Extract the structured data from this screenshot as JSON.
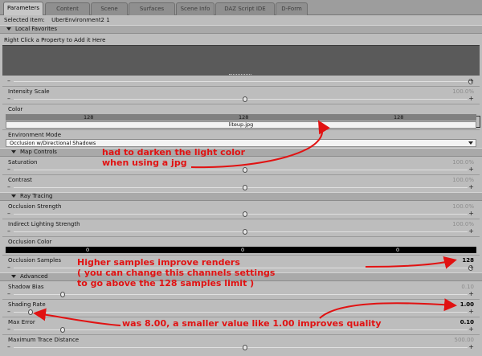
{
  "tabs": [
    "Parameters",
    "Content",
    "Scene",
    "Surfaces",
    "Scene Info",
    "DAZ Script IDE",
    "D-Form"
  ],
  "selected_item_label": "Selected Item:",
  "selected_item_value": "UberEnvironment2 1",
  "local_favorites": {
    "title": "Local Favorites",
    "hint": "Right Click a Property to Add it Here"
  },
  "top_slider_value": "",
  "intensity_scale": {
    "label": "Intensity Scale",
    "value": "100.0%"
  },
  "color": {
    "label": "Color",
    "r": "128",
    "g": "128",
    "b": "128",
    "file": "liteup.jpg"
  },
  "environment_mode": {
    "label": "Environment Mode",
    "value": "Occlusion w/Directional Shadows"
  },
  "map_controls": {
    "title": "Map Controls",
    "saturation": {
      "label": "Saturation",
      "value": "100.0%"
    },
    "contrast": {
      "label": "Contrast",
      "value": "100.0%"
    }
  },
  "ray_tracing": {
    "title": "Ray Tracing",
    "occlusion_strength": {
      "label": "Occlusion Strength",
      "value": "100.0%"
    },
    "indirect_strength": {
      "label": "Indirect Lighting Strength",
      "value": "100.0%"
    },
    "occlusion_color": {
      "label": "Occlusion Color",
      "r": "0",
      "g": "0",
      "b": "0"
    },
    "occlusion_samples": {
      "label": "Occlusion Samples",
      "value": "128"
    }
  },
  "advanced": {
    "title": "Advanced",
    "shadow_bias": {
      "label": "Shadow Bias",
      "value": "0.10"
    },
    "shading_rate": {
      "label": "Shading Rate",
      "value": "1.00"
    },
    "max_error": {
      "label": "Max Error",
      "value": "0.10"
    },
    "max_trace_distance": {
      "label": "Maximum Trace Distance",
      "value": "500.00"
    }
  },
  "annotations": {
    "color_note_line1": "had to darken the light color",
    "color_note_line2": "when using a jpg",
    "samples_note_line1": "Higher samples improve renders",
    "samples_note_line2": "( you can change this channels settings",
    "samples_note_line3": "to go above the 128 samples limit )",
    "shading_note": "was 8.00, a smaller value like 1.00 improves quality"
  },
  "colors": {
    "annotation_red": "#e11212",
    "panel_gray": "#bdbdbd",
    "swatch_gray": "#808080",
    "swatch_black": "#000000"
  },
  "sliders": {
    "top": 0.98,
    "intensity_scale": 0.5,
    "saturation": 0.5,
    "contrast": 0.5,
    "occlusion_strength": 0.5,
    "indirect_strength": 0.5,
    "occlusion_samples": 0.98,
    "shadow_bias": 0.1,
    "shading_rate": 0.04,
    "max_error": 0.1,
    "max_trace_distance": 0.5
  }
}
